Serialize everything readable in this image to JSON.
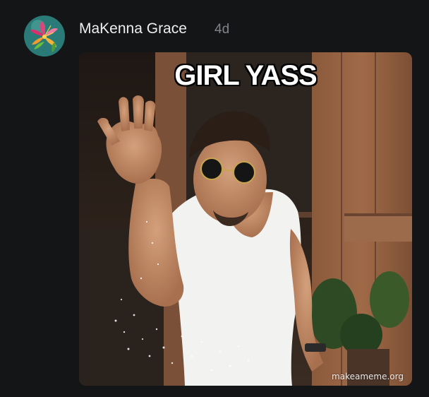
{
  "post": {
    "author": "MaKenna Grace",
    "timestamp": "4d",
    "avatar_icon": "flower-icon"
  },
  "meme": {
    "caption": "GIRL YASS",
    "watermark": "makeameme.org"
  },
  "colors": {
    "background": "#141517",
    "author_text": "#eceef0",
    "timestamp_text": "#80848a"
  }
}
